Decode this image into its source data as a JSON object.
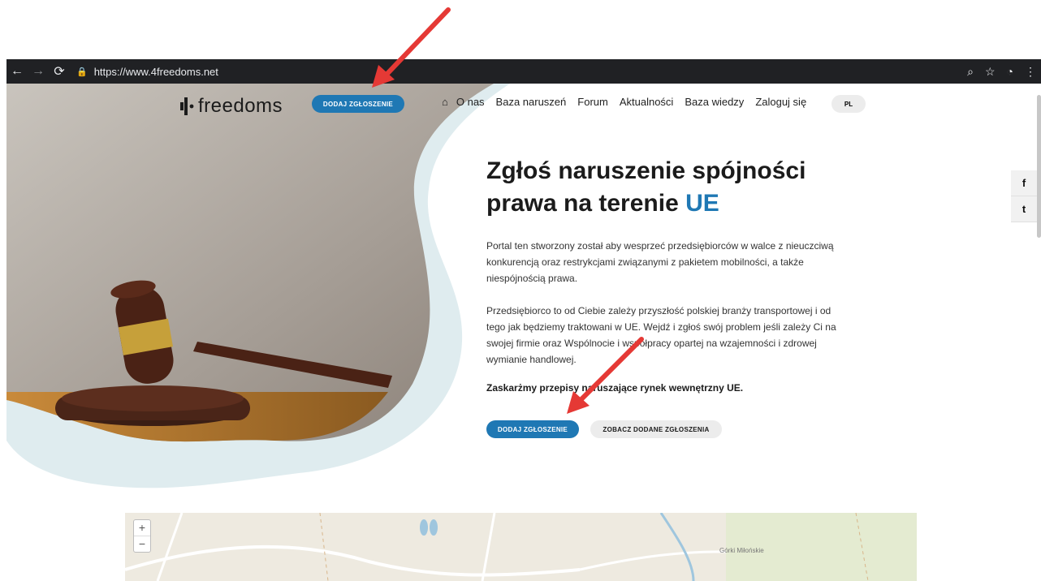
{
  "browser": {
    "url": "https://www.4freedoms.net",
    "back_icon": "arrow-left-icon",
    "forward_icon": "arrow-right-icon",
    "reload_icon": "reload-icon",
    "lock_icon": "lock-icon"
  },
  "header": {
    "logo_text": "freedoms",
    "add_report_label": "DODAJ ZGŁOSZENIE",
    "nav": [
      "O nas",
      "Baza naruszeń",
      "Forum",
      "Aktualności",
      "Baza wiedzy",
      "Zaloguj się"
    ],
    "lang": "PL"
  },
  "hero": {
    "title_main": "Zgłoś naruszenie spójności prawa na terenie ",
    "title_accent": "UE",
    "paragraph1": "Portal ten  stworzony został  aby wesprzeć przedsiębiorców w walce z nieuczciwą konkurencją oraz restrykcjami związanymi z pakietem mobilności,  a także niespójnością prawa.",
    "paragraph2": "Przedsiębiorco to od Ciebie zależy przyszłość polskiej branży transportowej i od tego jak będziemy traktowani w UE. Wejdź i zgłoś swój problem jeśli zależy Ci na swojej firmie oraz Wspólnocie i współpracy opartej na wzajemności i zdrowej wymianie handlowej.",
    "emphasis": "Zaskarżmy przepisy naruszające rynek wewnętrzny UE.",
    "cta_primary": "DODAJ ZGŁOSZENIE",
    "cta_secondary": "ZOBACZ DODANE ZGŁOSZENIA"
  },
  "social": {
    "facebook": "f",
    "twitter": "t"
  },
  "map": {
    "zoom_in": "+",
    "zoom_out": "−",
    "place_label": "Górki Miłońskie"
  },
  "colors": {
    "accent": "#1f78b4",
    "chrome": "#202124",
    "arrow": "#e53935"
  }
}
